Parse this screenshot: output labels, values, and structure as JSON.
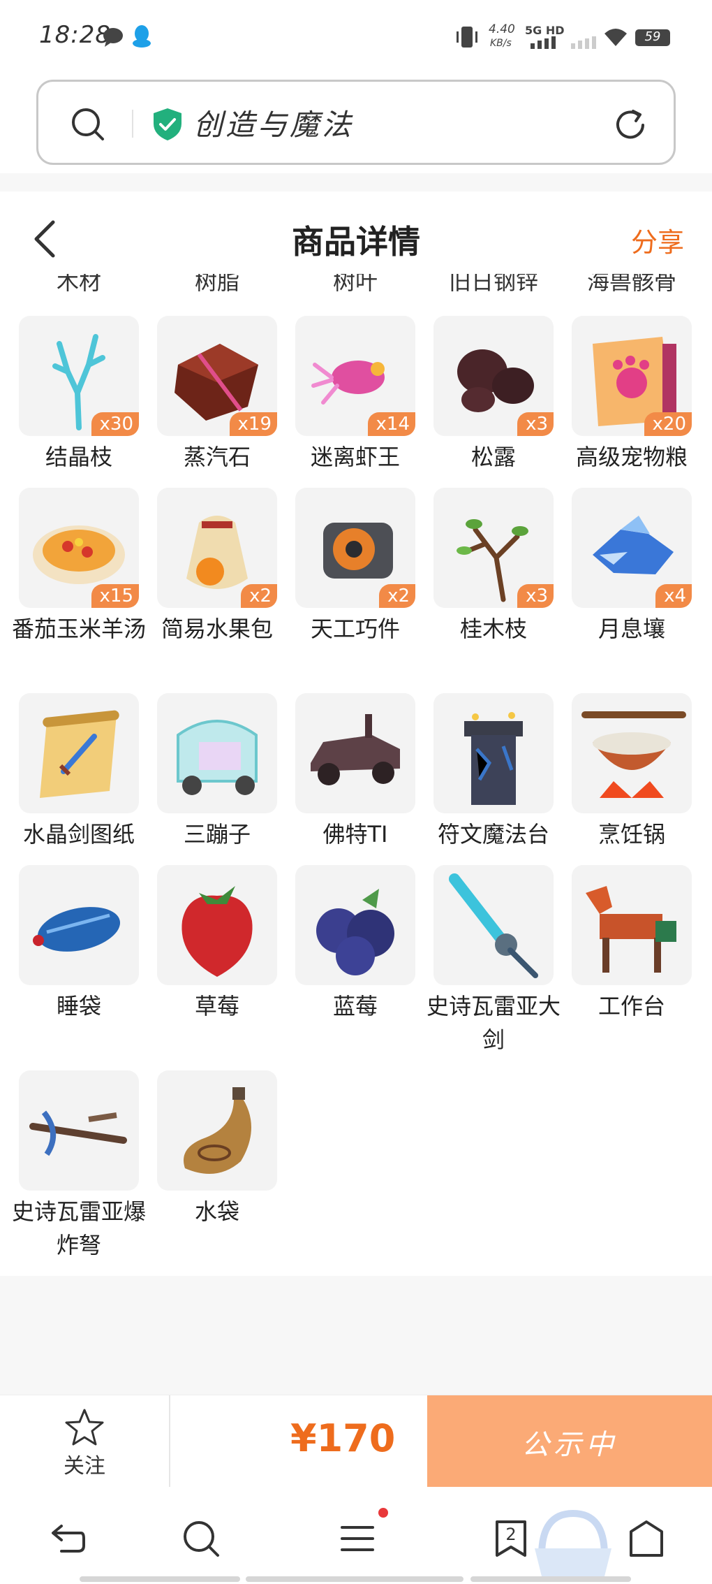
{
  "status_bar": {
    "time": "18:28",
    "net_speed": "4.40",
    "net_unit": "KB/s",
    "network": "5G HD",
    "battery": "59"
  },
  "search": {
    "site_title": "创造与魔法"
  },
  "header": {
    "title": "商品详情",
    "share": "分享"
  },
  "cut_labels": [
    "木材",
    "树脂",
    "树叶",
    "旧日钢锌",
    "海兽骸骨"
  ],
  "items": [
    {
      "name": "结晶枝",
      "qty": "x30",
      "icon": "crystal-branch-icon"
    },
    {
      "name": "蒸汽石",
      "qty": "x19",
      "icon": "steam-stone-icon"
    },
    {
      "name": "迷离虾王",
      "qty": "x14",
      "icon": "shrimp-king-icon"
    },
    {
      "name": "松露",
      "qty": "x3",
      "icon": "truffle-icon"
    },
    {
      "name": "高级宠物粮",
      "qty": "x20",
      "icon": "pet-food-icon"
    },
    {
      "name": "番茄玉米羊汤",
      "qty": "x15",
      "icon": "soup-icon"
    },
    {
      "name": "简易水果包",
      "qty": "x2",
      "icon": "fruit-bag-icon"
    },
    {
      "name": "天工巧件",
      "qty": "x2",
      "icon": "gear-part-icon"
    },
    {
      "name": "桂木枝",
      "qty": "x3",
      "icon": "branch-icon"
    },
    {
      "name": "月息壤",
      "qty": "x4",
      "icon": "moon-soil-icon"
    },
    {
      "name": "水晶剑图纸",
      "qty": "",
      "icon": "scroll-icon"
    },
    {
      "name": "三蹦子",
      "qty": "",
      "icon": "tricycle-icon"
    },
    {
      "name": "佛特TI",
      "qty": "",
      "icon": "car-icon"
    },
    {
      "name": "符文魔法台",
      "qty": "",
      "icon": "rune-altar-icon"
    },
    {
      "name": "烹饪锅",
      "qty": "",
      "icon": "cooking-pot-icon"
    },
    {
      "name": "睡袋",
      "qty": "",
      "icon": "sleeping-bag-icon"
    },
    {
      "name": "草莓",
      "qty": "",
      "icon": "strawberry-icon"
    },
    {
      "name": "蓝莓",
      "qty": "",
      "icon": "blueberry-icon"
    },
    {
      "name": "史诗瓦雷亚大剑",
      "qty": "",
      "icon": "sword-icon"
    },
    {
      "name": "工作台",
      "qty": "",
      "icon": "workbench-icon"
    },
    {
      "name": "史诗瓦雷亚爆炸弩",
      "qty": "",
      "icon": "crossbow-icon"
    },
    {
      "name": "水袋",
      "qty": "",
      "icon": "water-bag-icon"
    }
  ],
  "action_bar": {
    "follow_label": "关注",
    "price": "¥170",
    "status_label": "公示中"
  },
  "browser_nav": {
    "tab_count": "2"
  },
  "colors": {
    "accent": "#ee6c1d",
    "status_button": "#fbaa76",
    "badge": "#f28a47",
    "tile": "#f3f3f3"
  }
}
